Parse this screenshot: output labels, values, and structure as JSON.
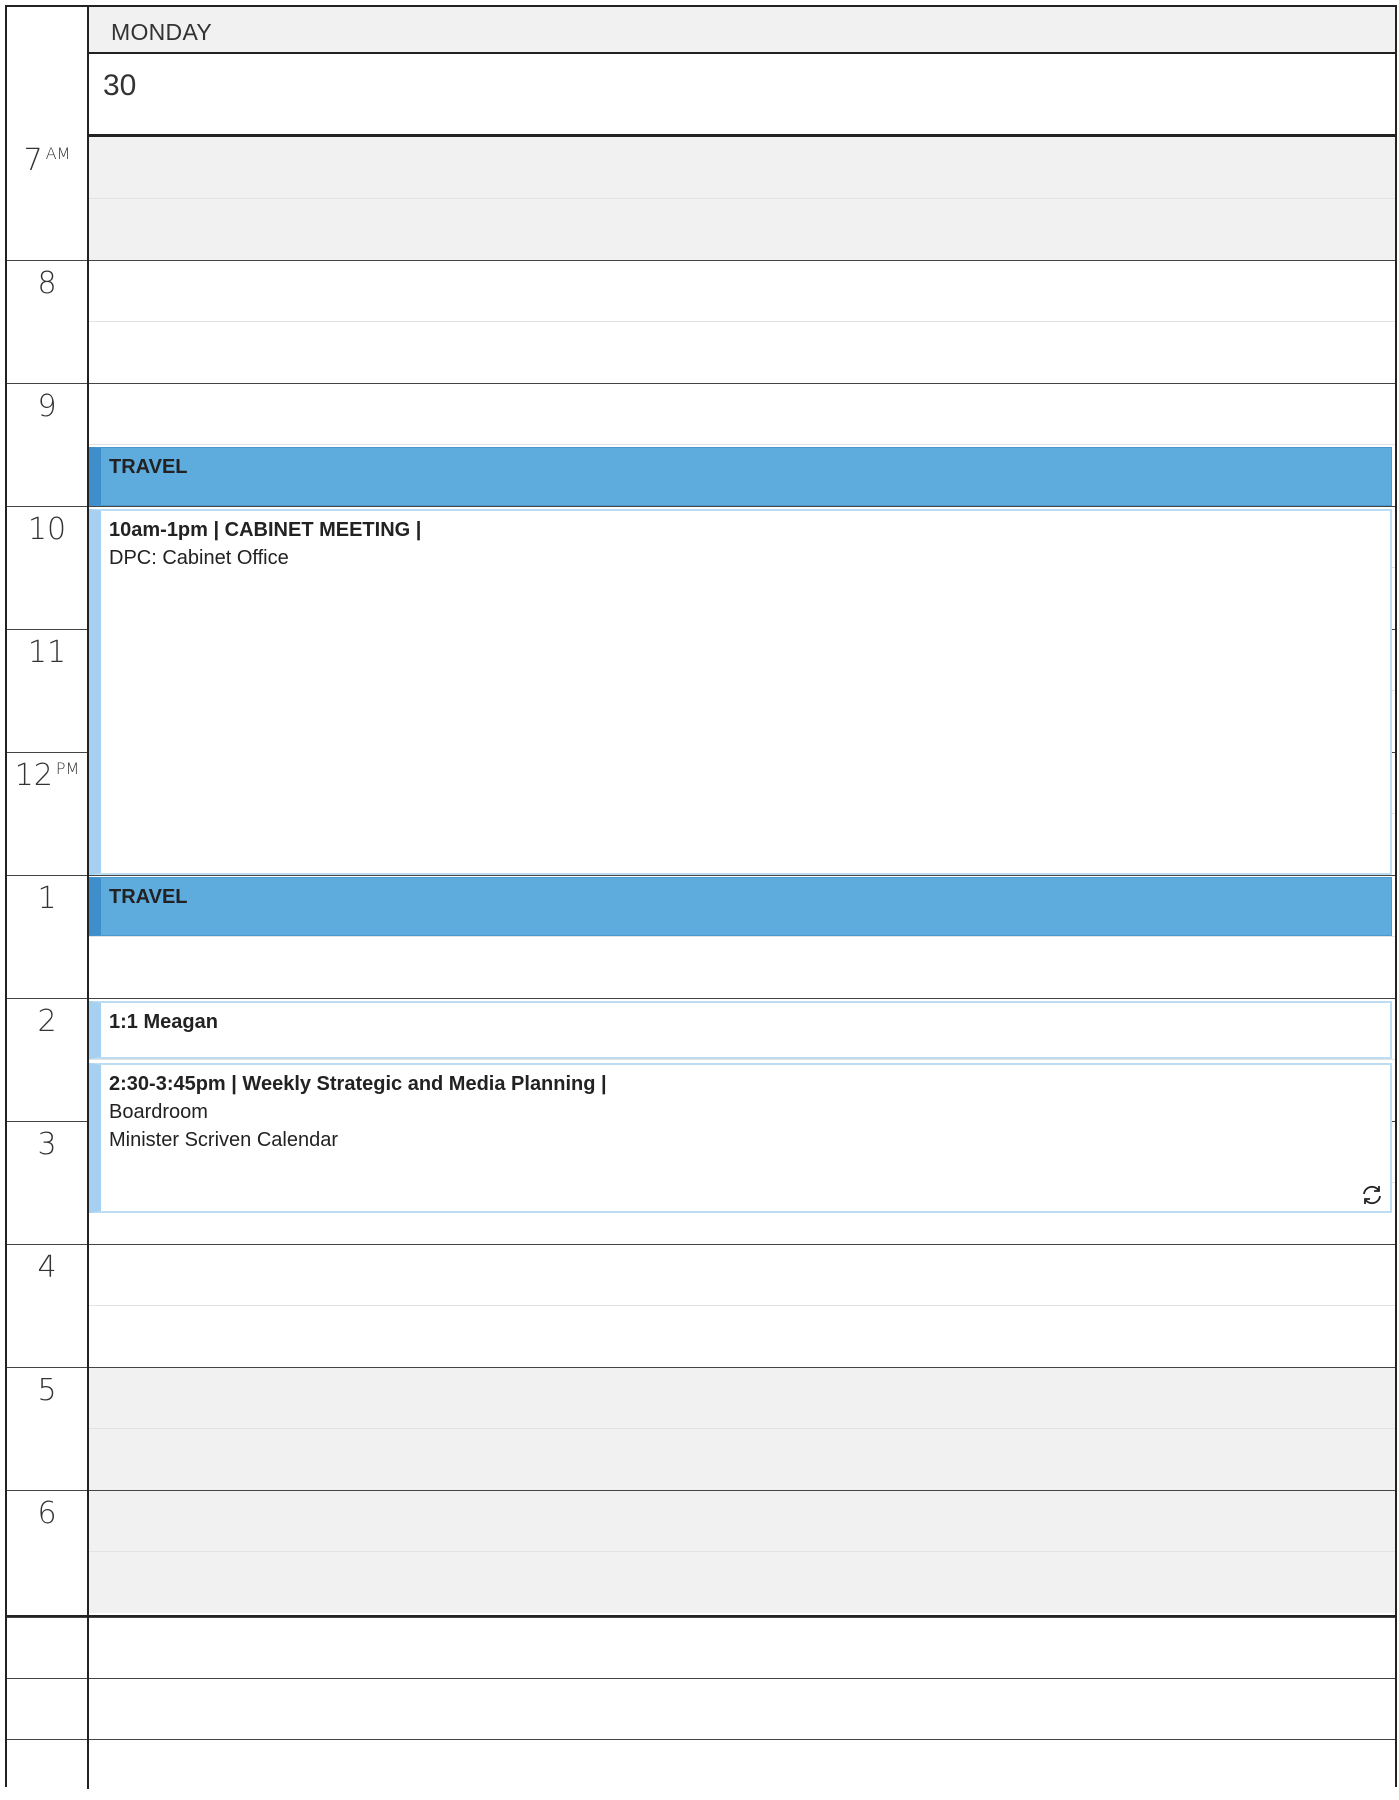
{
  "day": {
    "name": "MONDAY",
    "number": "30"
  },
  "hours": [
    {
      "label": "7",
      "meridiem": "AM",
      "off": true
    },
    {
      "label": "8",
      "meridiem": "",
      "off": false
    },
    {
      "label": "9",
      "meridiem": "",
      "off": false
    },
    {
      "label": "10",
      "meridiem": "",
      "off": false
    },
    {
      "label": "11",
      "meridiem": "",
      "off": false
    },
    {
      "label": "12",
      "meridiem": "PM",
      "off": false
    },
    {
      "label": "1",
      "meridiem": "",
      "off": false
    },
    {
      "label": "2",
      "meridiem": "",
      "off": false
    },
    {
      "label": "3",
      "meridiem": "",
      "off": false
    },
    {
      "label": "4",
      "meridiem": "",
      "off": false
    },
    {
      "label": "5",
      "meridiem": "",
      "off": true
    },
    {
      "label": "6",
      "meridiem": "",
      "off": true
    }
  ],
  "events": {
    "travel1": {
      "title": "TRAVEL"
    },
    "cabinet": {
      "title": "10am-1pm | CABINET MEETING |",
      "location": "DPC: Cabinet Office"
    },
    "travel2": {
      "title": "TRAVEL"
    },
    "meagan": {
      "title": "1:1 Meagan"
    },
    "weekly": {
      "title": "2:30-3:45pm | Weekly Strategic and Media Planning |",
      "location": "Boardroom",
      "calendar": "Minister Scriven Calendar",
      "recurring_icon": "recurring-icon"
    }
  },
  "colors": {
    "travel": "#5eabdd",
    "busy_accent": "#a6d0f0",
    "off_hours": "#f1f1f1"
  }
}
